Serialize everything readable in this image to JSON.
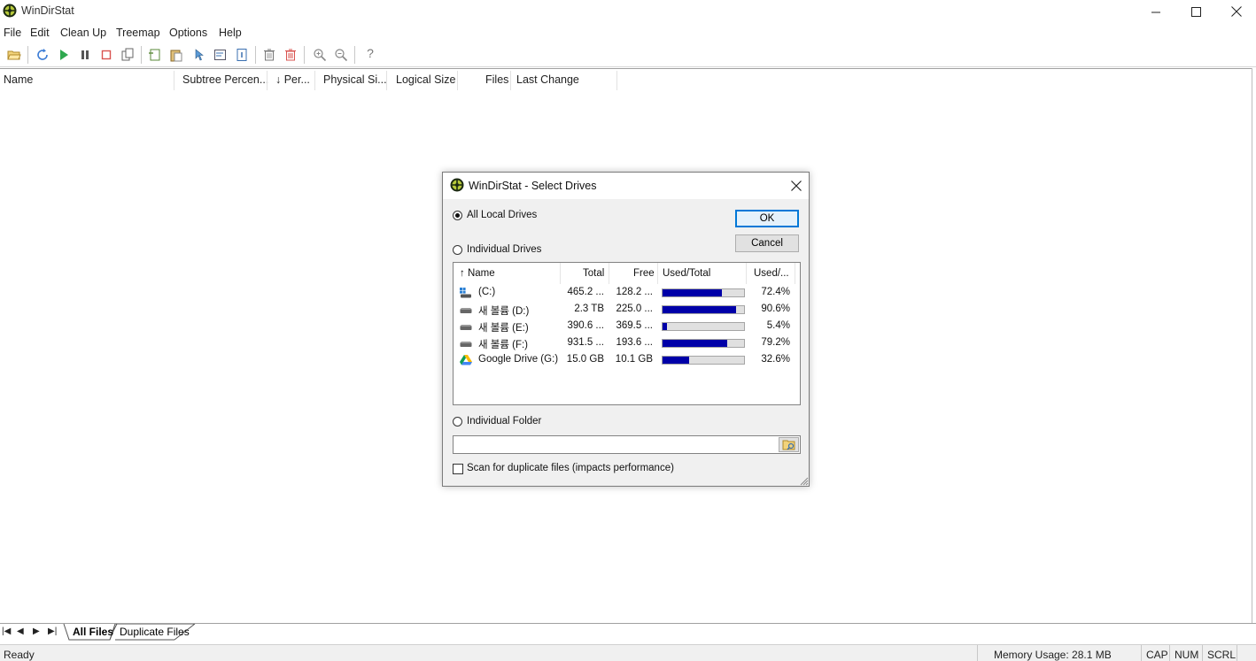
{
  "app": {
    "title": "WinDirStat",
    "icon": "windirstat-logo-icon"
  },
  "window_controls": [
    "minimize-icon",
    "maximize-icon",
    "close-icon"
  ],
  "menu": [
    "File",
    "Edit",
    "Clean Up",
    "Treemap",
    "Options",
    "Help"
  ],
  "toolbar_icons": [
    "open-icon",
    "refresh-icon",
    "resume-icon",
    "pause-icon",
    "stop-icon",
    "copy-path-icon",
    "new-folder-icon",
    "paste-icon",
    "select-icon",
    "edit-icon",
    "properties-icon",
    "delete-icon",
    "delete-permanently-icon",
    "zoom-in-icon",
    "zoom-out-icon",
    "help-icon"
  ],
  "columns": {
    "name": "Name",
    "subtree": "Subtree Percen...",
    "percent": "↓ Per...",
    "physical": "Physical Si...",
    "logical": "Logical Size",
    "files": "Files",
    "last_change": "Last Change"
  },
  "tabs": {
    "all_files": "All Files",
    "duplicate_files": "Duplicate Files"
  },
  "status": {
    "ready": "Ready",
    "memory": "Memory Usage: 28.1 MB",
    "cap": "CAP",
    "num": "NUM",
    "scrl": "SCRL"
  },
  "dialog": {
    "title": "WinDirStat - Select Drives",
    "all_local": "All Local Drives",
    "individual_drives": "Individual Drives",
    "individual_folder": "Individual Folder",
    "ok": "OK",
    "cancel": "Cancel",
    "duplicate_check": "Scan for duplicate files (impacts performance)",
    "list_headers": {
      "name": "↑ Name",
      "total": "Total",
      "free": "Free",
      "used_total": "Used/Total",
      "used_pct": "Used/..."
    },
    "drives": [
      {
        "name": " (C:)",
        "total": "465.2 ...",
        "free": "128.2 ...",
        "used_fraction": 0.724,
        "used_pct": "72.4%",
        "icon": "windows-drive-icon"
      },
      {
        "name": "새 볼륨 (D:)",
        "total": "2.3 TB",
        "free": "225.0 ...",
        "used_fraction": 0.906,
        "used_pct": "90.6%",
        "icon": "hard-drive-icon"
      },
      {
        "name": "새 볼륨 (E:)",
        "total": "390.6 ...",
        "free": "369.5 ...",
        "used_fraction": 0.054,
        "used_pct": "5.4%",
        "icon": "hard-drive-icon"
      },
      {
        "name": "새 볼륨 (F:)",
        "total": "931.5 ...",
        "free": "193.6 ...",
        "used_fraction": 0.792,
        "used_pct": "79.2%",
        "icon": "hard-drive-icon"
      },
      {
        "name": "Google Drive (G:)",
        "total": "15.0 GB",
        "free": "10.1 GB",
        "used_fraction": 0.326,
        "used_pct": "32.6%",
        "icon": "google-drive-icon"
      }
    ],
    "selected_option": "all_local",
    "duplicate_checked": false
  }
}
